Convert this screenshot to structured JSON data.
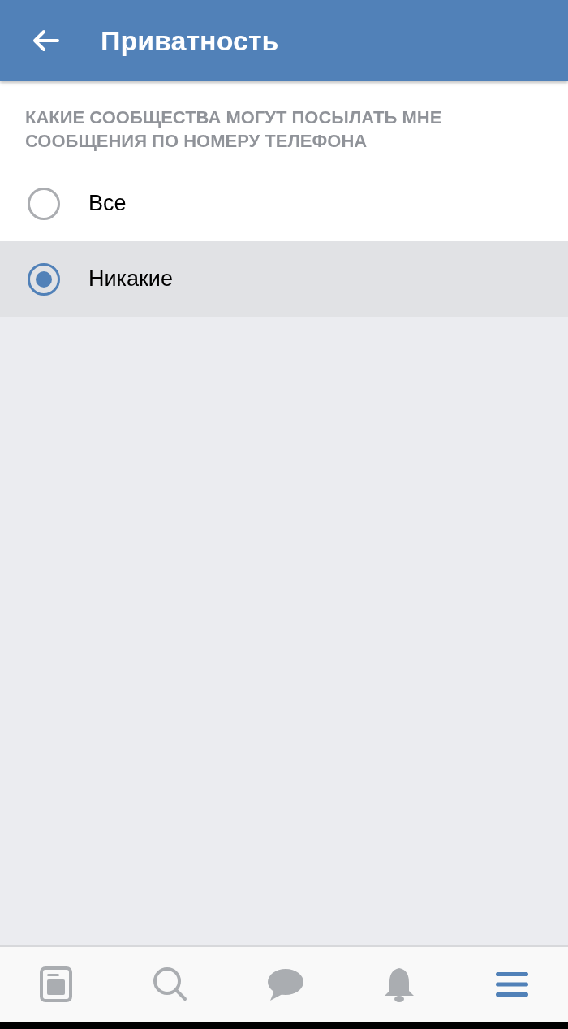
{
  "header": {
    "title": "Приватность"
  },
  "section": {
    "heading": "КАКИЕ СООБЩЕСТВА МОГУТ ПОСЫЛАТЬ МНЕ СООБЩЕНИЯ ПО НОМЕРУ ТЕЛЕФОНА",
    "options": [
      {
        "label": "Все",
        "selected": false
      },
      {
        "label": "Никакие",
        "selected": true
      }
    ]
  },
  "tab_bar": [
    {
      "kind": "news",
      "selected": false
    },
    {
      "kind": "search",
      "selected": false
    },
    {
      "kind": "messages",
      "selected": false
    },
    {
      "kind": "notifications",
      "selected": false
    },
    {
      "kind": "menu",
      "selected": true
    }
  ]
}
